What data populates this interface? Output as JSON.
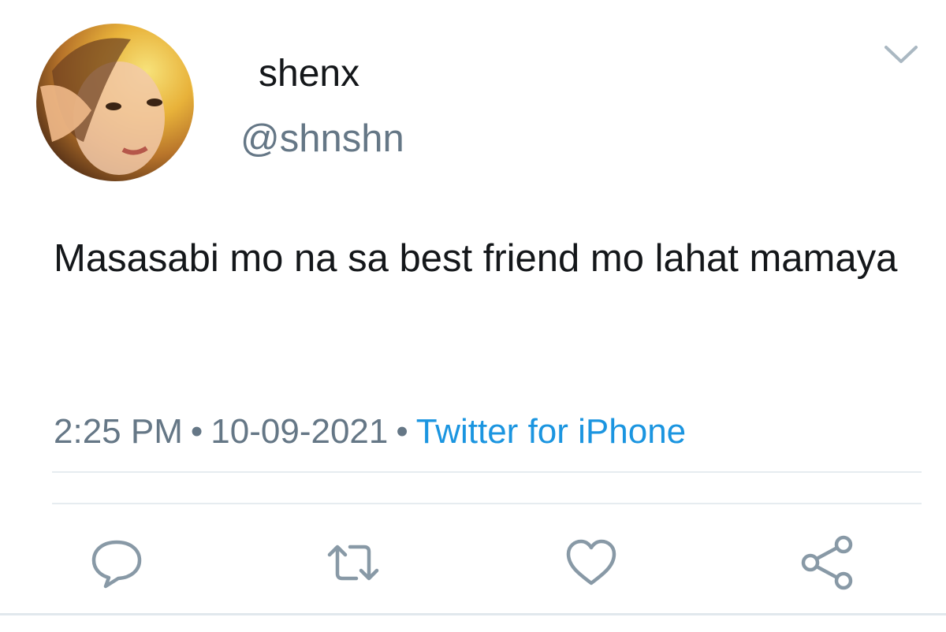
{
  "tweet": {
    "author": {
      "display_name": "shenx",
      "handle": "@shnshn"
    },
    "text": "Masasabi mo na sa best friend mo lahat mamaya",
    "time": "2:25 PM",
    "separator": "•",
    "date": "10-09-2021",
    "source": "Twitter for iPhone"
  },
  "icons": {
    "menu": "chevron-down-icon",
    "reply": "reply-icon",
    "retweet": "retweet-icon",
    "like": "heart-icon",
    "share": "share-icon"
  },
  "colors": {
    "text": "#14171a",
    "secondary": "#657786",
    "link": "#1b95e0",
    "icon": "#657786",
    "divider": "#e6ecf0"
  }
}
